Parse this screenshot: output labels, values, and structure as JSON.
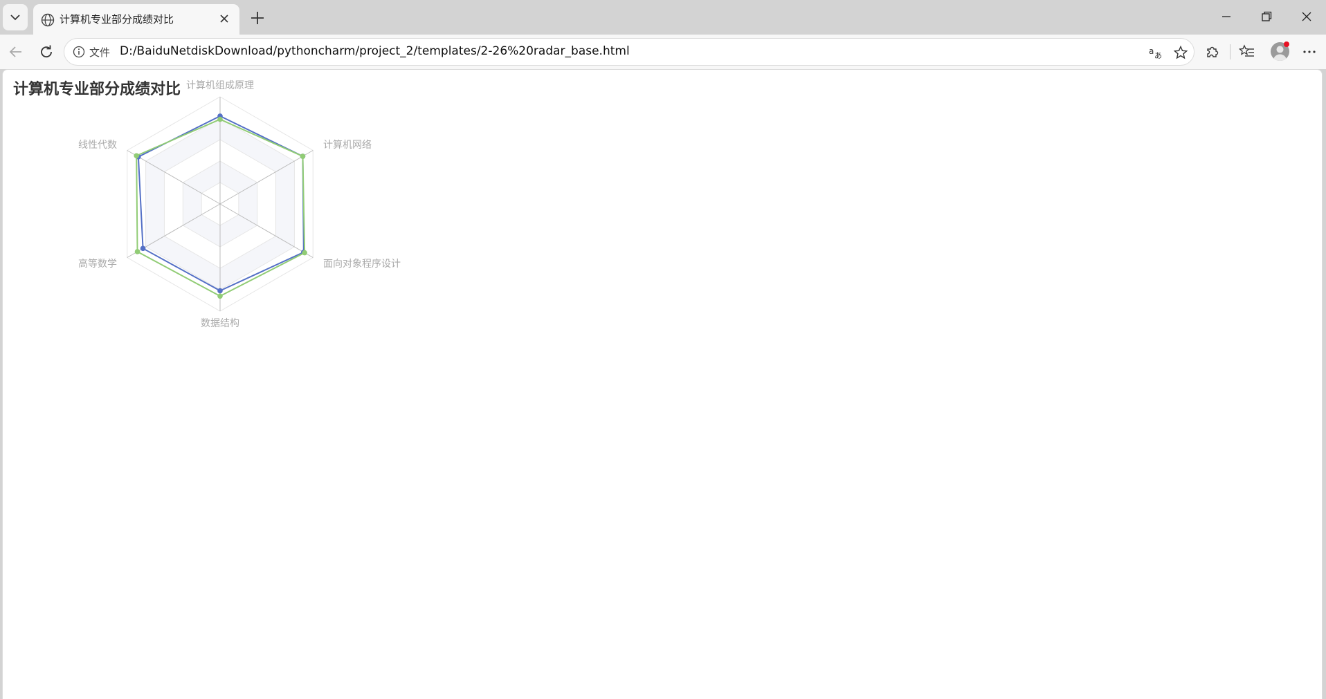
{
  "browser": {
    "tab": {
      "title": "计算机专业部分成绩对比",
      "icon": "globe-icon"
    },
    "address": {
      "security_label": "文件",
      "url": "D:/BaiduNetdiskDownload/pythoncharm/project_2/templates/2-26%20radar_base.html"
    }
  },
  "page": {
    "title": "计算机专业部分成绩对比"
  },
  "chart_data": {
    "type": "radar",
    "title": "计算机专业部分成绩对比",
    "indicators": [
      "计算机组成原理",
      "计算机网络",
      "面向对象程序设计",
      "数据结构",
      "高等数学",
      "线性代数"
    ],
    "max": 100,
    "split_number": 5,
    "grid": true,
    "series": [
      {
        "color": "#5470c6",
        "values": [
          82,
          89,
          90,
          81,
          83,
          88
        ]
      },
      {
        "color": "#91cc75",
        "values": [
          79,
          89,
          91,
          86,
          89,
          90
        ]
      }
    ]
  }
}
